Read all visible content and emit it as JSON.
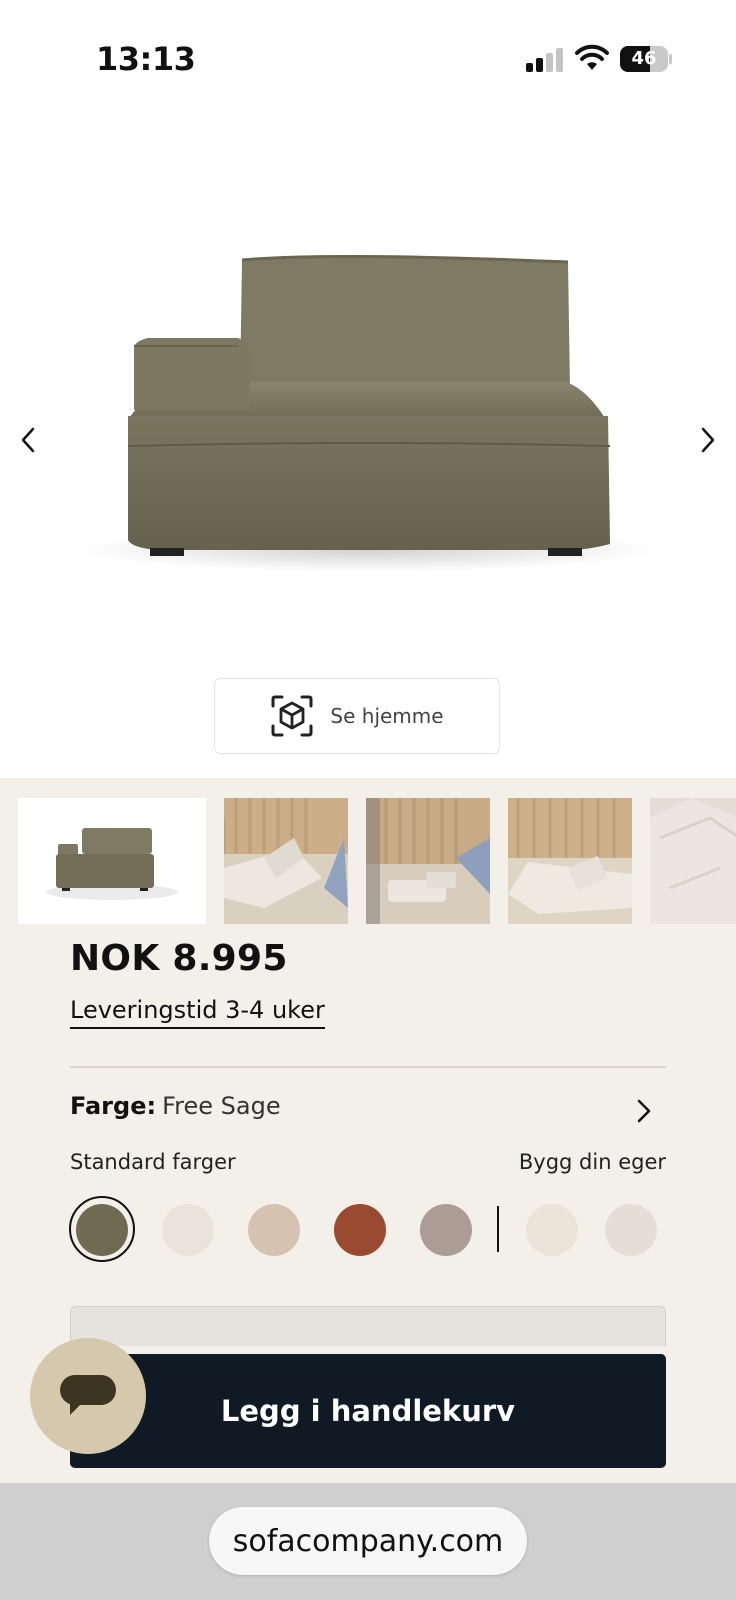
{
  "status_bar": {
    "time": "13:13",
    "battery": "46",
    "signal_icon": "cellular-signal-icon",
    "wifi_icon": "wifi-icon"
  },
  "product": {
    "image_alt": "Sofa module – chaise with left armrest",
    "prev_icon": "chevron-left-icon",
    "next_icon": "chevron-right-icon",
    "ar_button_label": "Se hjemme",
    "ar_icon": "ar-cube-icon",
    "thumbnails": [
      {
        "kind": "product-photo"
      },
      {
        "kind": "room-photo"
      },
      {
        "kind": "room-photo"
      },
      {
        "kind": "room-photo"
      },
      {
        "kind": "room-photo"
      }
    ],
    "price": "NOK 8.995",
    "delivery_link": "Leveringstid 3-4 uker"
  },
  "color": {
    "label": "Farge:",
    "value": "Free Sage",
    "chevron_icon": "chevron-right-icon",
    "standard_label": "Standard farger",
    "build_label": "Bygg din eger",
    "standard_swatches": [
      "#6f6b52",
      "#ebe3da",
      "#d6c2b0",
      "#9a4a30",
      "#ab9d94"
    ],
    "custom_swatches": [
      "#ece4d8",
      "#e4dfd6"
    ],
    "selected_index": 0
  },
  "cart": {
    "add_button_label": "Legg i handlekurv"
  },
  "chat": {
    "icon": "chat-bubble-icon"
  },
  "browser": {
    "url": "sofacompany.com"
  },
  "colors": {
    "page_bg": "#f3f0ea",
    "cart_button": "#0f1a24",
    "chat_bg": "#d5c9ad",
    "browser_bar": "#cfcfcf"
  }
}
